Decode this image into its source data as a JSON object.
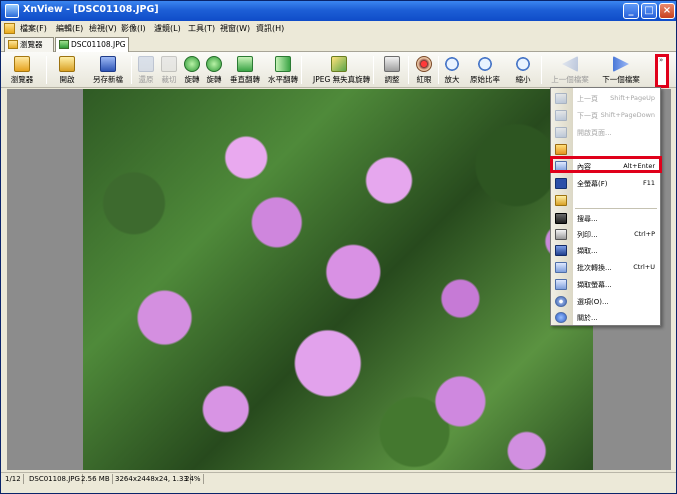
{
  "window": {
    "title": "XnView - [DSC01108.JPG]",
    "buttons": {
      "minimize": "_",
      "maximize": "□",
      "close": "×"
    }
  },
  "menu": [
    "檔案(F)",
    "編輯(E)",
    "檢視(V)",
    "影像(I)",
    "濾鏡(L)",
    "工具(T)",
    "視窗(W)",
    "資訊(H)"
  ],
  "tabs": [
    {
      "label": "瀏覽器",
      "active": false
    },
    {
      "label": "DSC01108.JPG",
      "active": true
    }
  ],
  "toolbar": {
    "items": [
      {
        "label": "瀏覽器",
        "icon": "browser-icon",
        "enabled": true
      },
      {
        "label": "開啟",
        "icon": "open-folder-icon",
        "enabled": true
      },
      {
        "label": "另存新檔",
        "icon": "save-icon",
        "enabled": true
      },
      {
        "label": "還原",
        "icon": "undo-icon",
        "enabled": false
      },
      {
        "label": "裁切",
        "icon": "crop-icon",
        "enabled": false
      },
      {
        "label": "旋轉",
        "icon": "rotate-left-icon",
        "enabled": true
      },
      {
        "label": "旋轉",
        "icon": "rotate-right-icon",
        "enabled": true
      },
      {
        "label": "垂直翻轉",
        "icon": "flip-vertical-icon",
        "enabled": true
      },
      {
        "label": "水平翻轉",
        "icon": "flip-horizontal-icon",
        "enabled": true
      },
      {
        "label": "JPEG 無失真旋轉",
        "icon": "jpeg-lossless-rotate-icon",
        "enabled": true
      },
      {
        "label": "調整",
        "icon": "adjust-icon",
        "enabled": true
      },
      {
        "label": "紅眼",
        "icon": "red-eye-icon",
        "enabled": true
      },
      {
        "label": "放大",
        "icon": "zoom-in-icon",
        "enabled": true
      },
      {
        "label": "原始比率",
        "icon": "zoom-original-icon",
        "enabled": true
      },
      {
        "label": "縮小",
        "icon": "zoom-out-icon",
        "enabled": true
      },
      {
        "label": "上一個檔案",
        "icon": "previous-file-icon",
        "enabled": false
      },
      {
        "label": "下一個檔案",
        "icon": "next-file-icon",
        "enabled": true
      }
    ],
    "overflow": "»"
  },
  "context_menu": [
    {
      "label": "上一頁",
      "shortcut": "Shift+PageUp",
      "enabled": false,
      "icon": "previous-page-icon"
    },
    {
      "label": "下一頁",
      "shortcut": "Shift+PageDown",
      "enabled": false,
      "icon": "next-page-icon"
    },
    {
      "label": "開啟頁面...",
      "shortcut": "",
      "enabled": false,
      "icon": "open-page-icon"
    },
    {
      "label": "",
      "shortcut": "",
      "enabled": true,
      "icon": "image-icon"
    },
    {
      "label": "內容",
      "shortcut": "Alt+Enter",
      "enabled": true,
      "icon": "properties-icon"
    },
    {
      "label": "全螢幕(F)",
      "shortcut": "F11",
      "enabled": true,
      "icon": "fullscreen-icon"
    },
    {
      "label": "",
      "shortcut": "",
      "enabled": true,
      "icon": "folder-icon"
    },
    {
      "label": "搜尋...",
      "shortcut": "",
      "enabled": true,
      "icon": "search-icon"
    },
    {
      "label": "列印...",
      "shortcut": "Ctrl+P",
      "enabled": true,
      "icon": "print-icon"
    },
    {
      "label": "擷取...",
      "shortcut": "",
      "enabled": true,
      "icon": "capture-icon"
    },
    {
      "label": "批次轉換...",
      "shortcut": "Ctrl+U",
      "enabled": true,
      "icon": "batch-convert-icon"
    },
    {
      "label": "擷取螢幕...",
      "shortcut": "",
      "enabled": true,
      "icon": "screen-capture-icon"
    },
    {
      "label": "選項(O)...",
      "shortcut": "",
      "enabled": true,
      "icon": "options-icon"
    },
    {
      "label": "關於...",
      "shortcut": "",
      "enabled": true,
      "icon": "help-icon"
    }
  ],
  "status": {
    "page": "1/12",
    "filename": "DSC01108.JPG",
    "filesize": "2.56 MB",
    "dimensions": "3264x2448x24, 1.33",
    "zoom": "24%"
  },
  "colors": {
    "titlebar": "#1d5fd6",
    "highlight": "#e0001a",
    "viewer_bg": "#8c8c8c"
  }
}
